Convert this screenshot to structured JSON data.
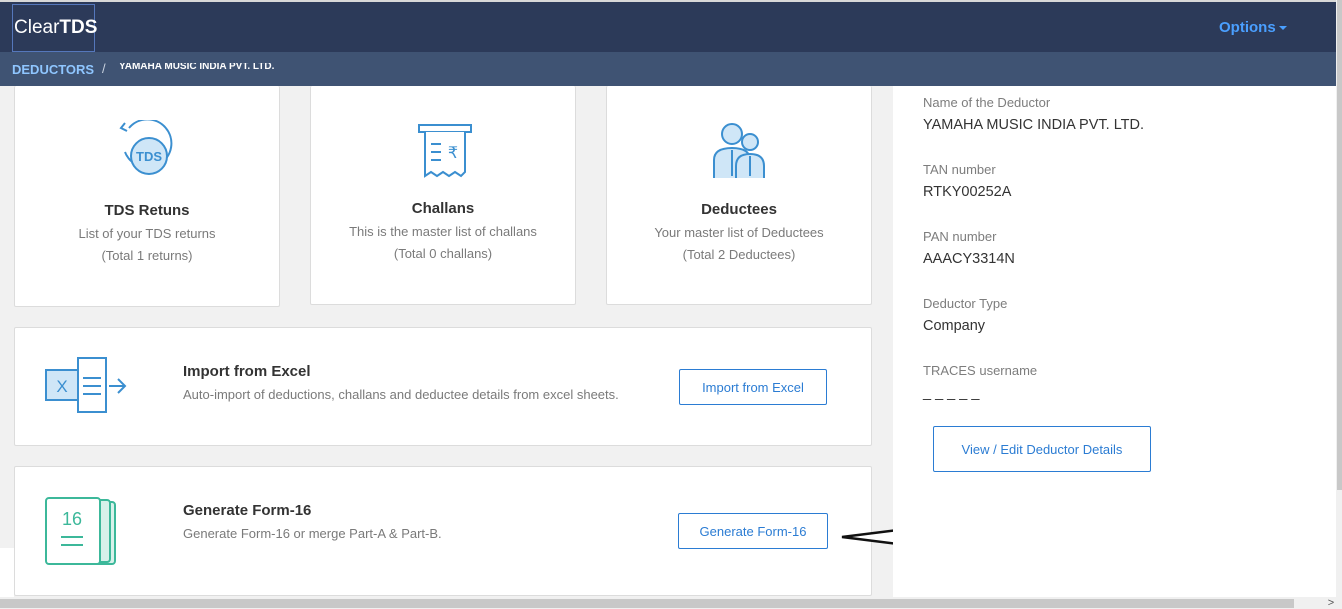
{
  "app": {
    "logo_light": "Clear",
    "logo_bold": "TDS",
    "options_label": "Options"
  },
  "breadcrumb": {
    "root": "DEDUCTORS",
    "separator": "/",
    "current": "YAMAHA MUSIC INDIA PVT. LTD."
  },
  "tiles": {
    "returns": {
      "title": "TDS Retuns",
      "desc": "List of your TDS returns",
      "count": "(Total 1 returns)",
      "icon": "tds-return-icon",
      "icon_text": "TDS"
    },
    "challans": {
      "title": "Challans",
      "desc": "This is the master list of challans",
      "count": "(Total 0 challans)",
      "icon": "receipt-rupee-icon",
      "icon_text": "₹"
    },
    "deductees": {
      "title": "Deductees",
      "desc": "Your master list of Deductees",
      "count": "(Total 2 Deductees)",
      "icon": "people-icon"
    }
  },
  "import_card": {
    "title": "Import from Excel",
    "desc": "Auto-import of deductions, challans and deductee details from excel sheets.",
    "button": "Import from Excel",
    "icon": "excel-import-icon",
    "icon_text": "X"
  },
  "form16_card": {
    "title": "Generate Form-16",
    "desc": "Generate Form-16 or merge Part-A & Part-B.",
    "button": "Generate Form-16",
    "icon": "form16-icon",
    "icon_text": "16"
  },
  "deductor": {
    "name_label": "Name of the Deductor",
    "name_value": "YAMAHA MUSIC INDIA PVT. LTD.",
    "tan_label": "TAN number",
    "tan_value": "RTKY00252A",
    "pan_label": "PAN number",
    "pan_value": "AAACY3314N",
    "type_label": "Deductor Type",
    "type_value": "Company",
    "traces_label": "TRACES username",
    "traces_value": "_ _ _ _ _",
    "edit_button": "View / Edit Deductor Details"
  },
  "colors": {
    "topbar": "#2c3a59",
    "breadcrumb_bar": "#3f5373",
    "accent_blue": "#2b7cd3",
    "icon_blue": "#3b8fd0",
    "icon_green": "#3cb89a"
  }
}
